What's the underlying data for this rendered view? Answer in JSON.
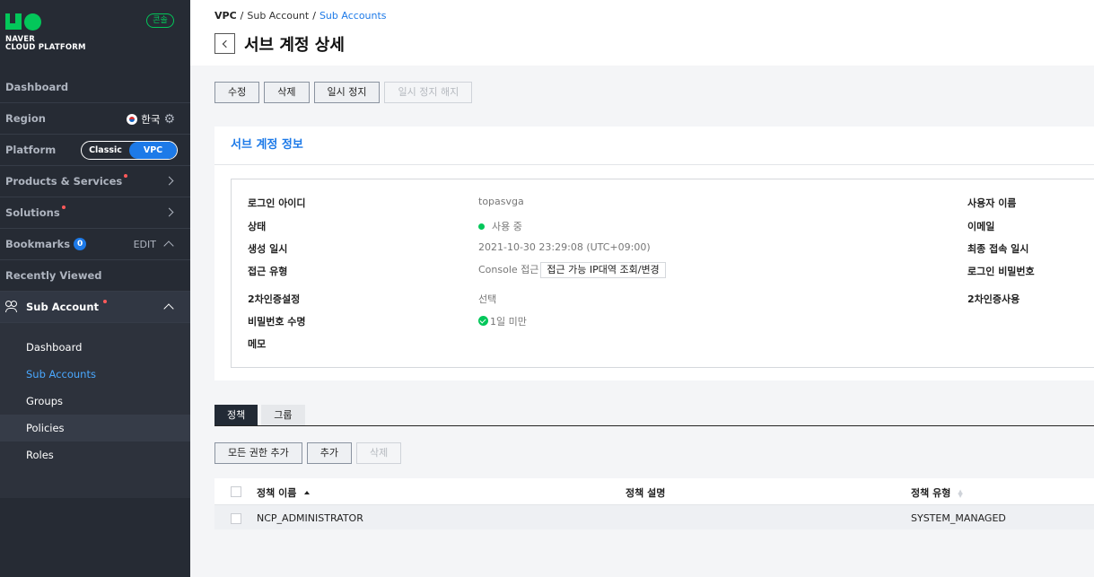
{
  "brand": {
    "line1": "NAVER",
    "line2": "CLOUD PLATFORM",
    "console_badge": "콘솔"
  },
  "sidebar": {
    "dashboard": "Dashboard",
    "region": {
      "label": "Region",
      "value": "한국"
    },
    "platform": {
      "label": "Platform",
      "options": [
        "Classic",
        "VPC"
      ],
      "selected": "VPC"
    },
    "products": "Products & Services",
    "solutions": "Solutions",
    "bookmarks": {
      "label": "Bookmarks",
      "count": "0",
      "edit": "EDIT"
    },
    "recently_viewed": "Recently Viewed",
    "sub_account": {
      "label": "Sub Account",
      "items": [
        "Dashboard",
        "Sub Accounts",
        "Groups",
        "Policies",
        "Roles"
      ],
      "active": "Sub Accounts"
    }
  },
  "breadcrumb": [
    "VPC",
    "Sub Account",
    "Sub Accounts"
  ],
  "page_title": "서브 계정 상세",
  "actions": {
    "edit": "수정",
    "delete": "삭제",
    "suspend": "일시 정지",
    "unsuspend": "일시 정지 해지"
  },
  "info": {
    "title": "서브 계정 정보",
    "fields": {
      "login_id": {
        "label": "로그인 아이디",
        "value": "topasvga"
      },
      "status": {
        "label": "상태",
        "value": "사용 중"
      },
      "created": {
        "label": "생성 일시",
        "value": "2021-10-30 23:29:08 (UTC+09:00)"
      },
      "access_type": {
        "label": "접근 유형",
        "value": "Console 접근",
        "button": "접근 가능 IP대역 조회/변경"
      },
      "two_factor": {
        "label": "2차인증설정",
        "value": "선택"
      },
      "pw_life": {
        "label": "비밀번호 수명",
        "value": "1일 미만"
      },
      "memo": {
        "label": "메모",
        "value": ""
      },
      "username": {
        "label": "사용자 이름"
      },
      "email": {
        "label": "이메일"
      },
      "last_login": {
        "label": "최종 접속 일시"
      },
      "login_pw": {
        "label": "로그인 비밀번호"
      },
      "two_factor_use": {
        "label": "2차인증사용"
      }
    }
  },
  "tabs": [
    "정책",
    "그룹"
  ],
  "policy_actions": {
    "add_all": "모든 권한 추가",
    "add": "추가",
    "delete": "삭제"
  },
  "policy_table": {
    "columns": [
      "정책 이름",
      "정책 설명",
      "정책 유형"
    ],
    "rows": [
      {
        "name": "NCP_ADMINISTRATOR",
        "desc": "",
        "type": "SYSTEM_MANAGED"
      }
    ]
  },
  "colors": {
    "accent": "#1d7ae8",
    "green": "#03c75a",
    "sidebar_bg": "#262b34"
  }
}
